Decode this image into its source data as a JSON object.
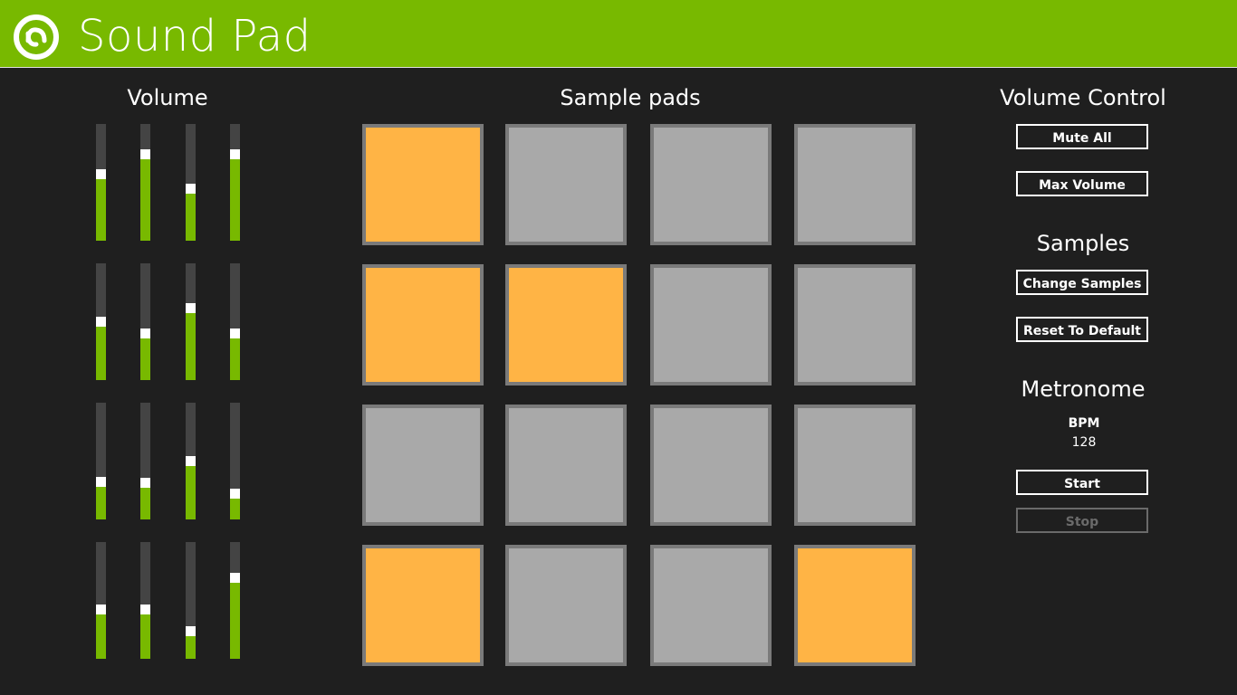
{
  "app": {
    "title": "Sound Pad"
  },
  "volume": {
    "title": "Volume",
    "levels": [
      [
        0.53,
        0.7,
        0.4,
        0.7
      ],
      [
        0.46,
        0.36,
        0.57,
        0.36
      ],
      [
        0.28,
        0.27,
        0.46,
        0.18
      ],
      [
        0.38,
        0.38,
        0.19,
        0.65
      ]
    ]
  },
  "pads": {
    "title": "Sample pads",
    "active": [
      [
        true,
        false,
        false,
        false
      ],
      [
        true,
        true,
        false,
        false
      ],
      [
        false,
        false,
        false,
        false
      ],
      [
        true,
        false,
        false,
        true
      ]
    ]
  },
  "controls": {
    "volume_title": "Volume Control",
    "mute_all": "Mute All",
    "max_volume": "Max Volume",
    "samples_title": "Samples",
    "change_samples": "Change Samples",
    "reset_default": "Reset To Default",
    "metronome_title": "Metronome",
    "bpm_label": "BPM",
    "bpm_value": "128",
    "start": "Start",
    "stop": "Stop"
  },
  "colors": {
    "accent": "#78b900",
    "pad_active": "#ffb445",
    "pad_inactive": "#a9a9a9",
    "background": "#1f1f1f"
  }
}
